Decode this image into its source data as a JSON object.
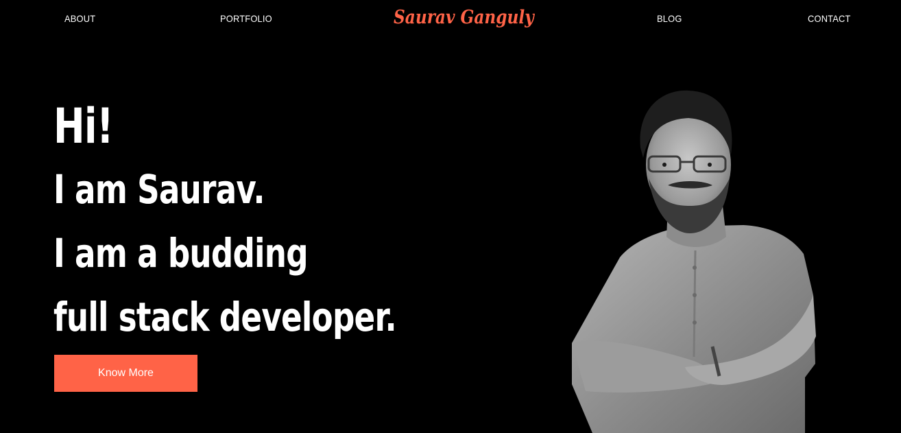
{
  "nav": {
    "about": "ABOUT",
    "portfolio": "PORTFOLIO",
    "logo": "Saurav Ganguly",
    "blog": "BLOG",
    "contact": "CONTACT"
  },
  "hero": {
    "greeting": "Hi!",
    "line1": "I am Saurav.",
    "line2": "I am a budding",
    "line3": "full stack developer.",
    "cta_label": "Know More"
  },
  "colors": {
    "background": "#000000",
    "accent": "#ff6347",
    "text": "#ffffff"
  },
  "icons": {
    "portrait": "grayscale-portrait-photo"
  }
}
